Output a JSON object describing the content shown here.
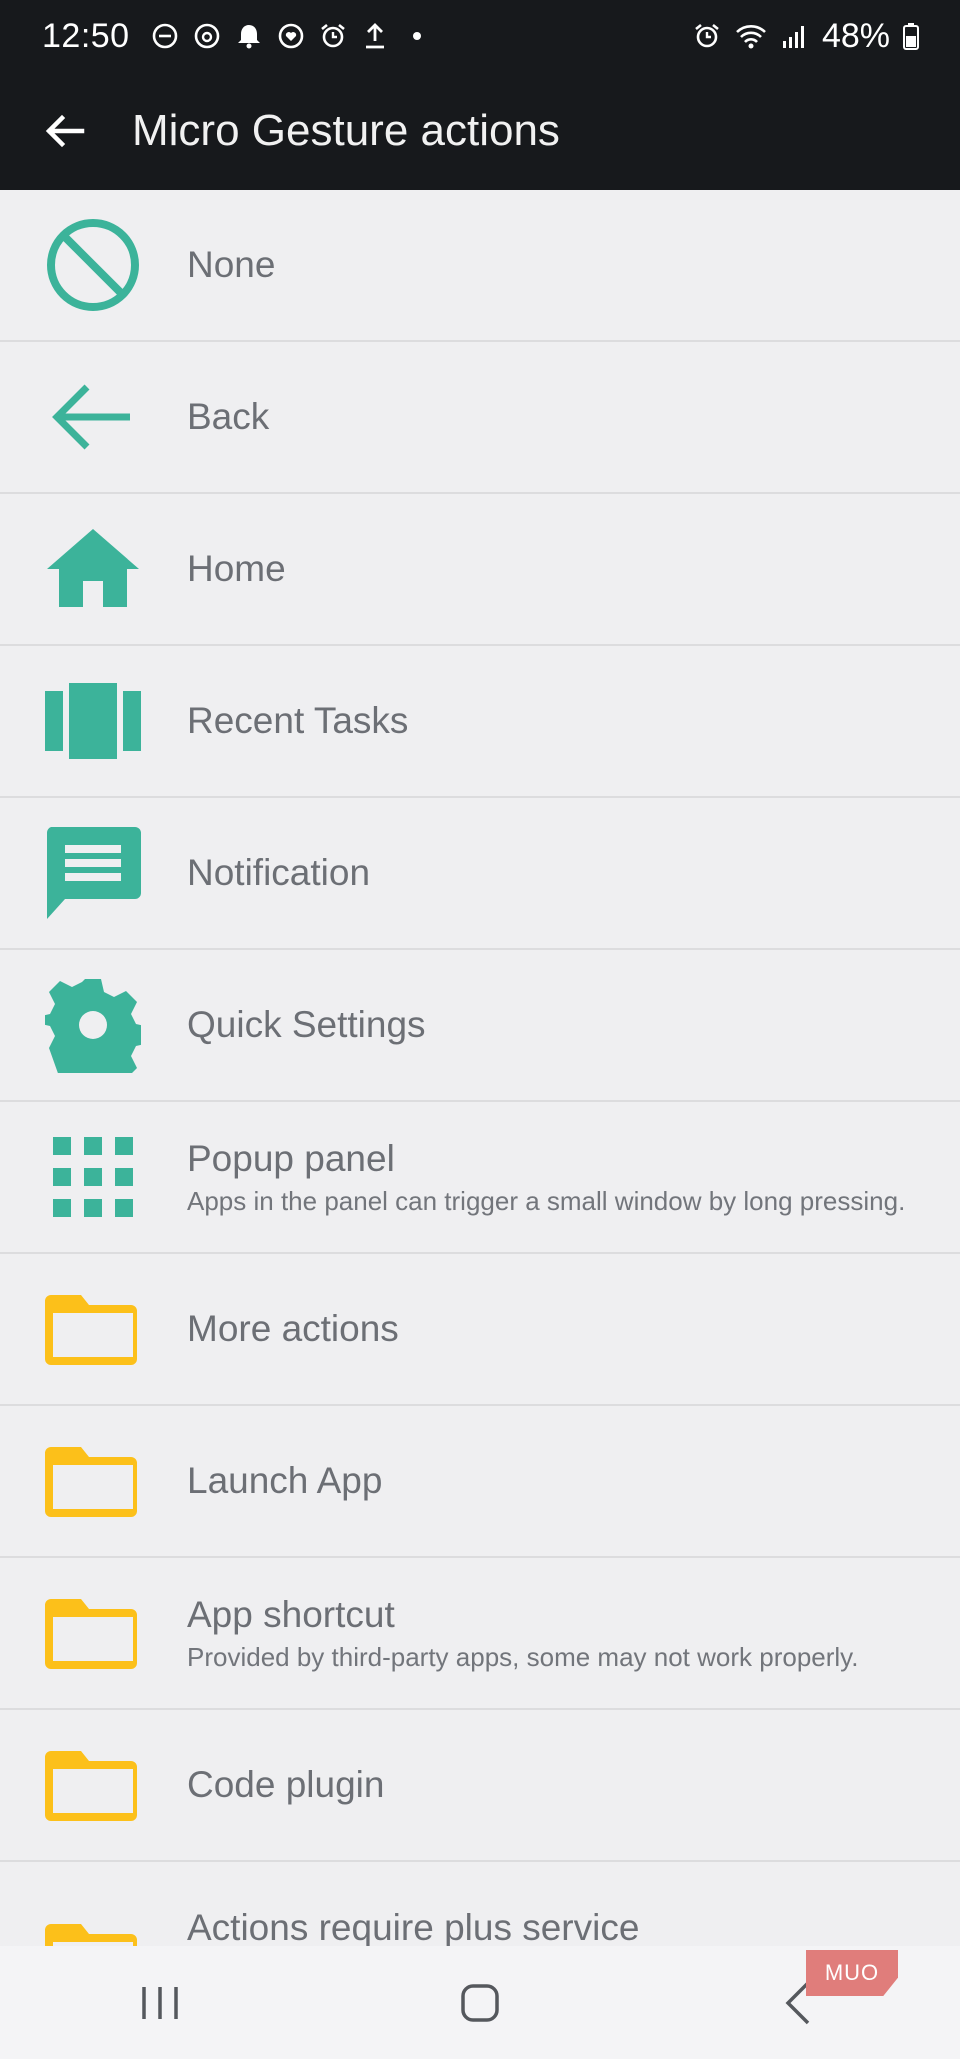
{
  "status_bar": {
    "time": "12:50",
    "battery": "48%",
    "icons_left": [
      "dnd-icon",
      "threads-icon",
      "bell-icon",
      "heart-sync-icon",
      "alarm-icon",
      "upload-icon",
      "dot-icon"
    ],
    "icons_right": [
      "alarm-icon",
      "wifi-icon",
      "signal-icon",
      "battery-icon"
    ]
  },
  "app_bar": {
    "title": "Micro Gesture actions",
    "back_icon": "arrow-left-icon"
  },
  "colors": {
    "accent_teal": "#3cb39a",
    "folder_yellow": "#fcc01a",
    "bar_dark": "#17191c",
    "list_bg": "#efeff1",
    "text_gray": "#6c6f75"
  },
  "items": [
    {
      "title": "None",
      "icon": "none-icon"
    },
    {
      "title": "Back",
      "icon": "back-arrow-icon"
    },
    {
      "title": "Home",
      "icon": "home-icon"
    },
    {
      "title": "Recent Tasks",
      "icon": "recent-tasks-icon"
    },
    {
      "title": "Notification",
      "icon": "notification-icon"
    },
    {
      "title": "Quick Settings",
      "icon": "gear-icon"
    },
    {
      "title": "Popup panel",
      "subtitle": "Apps in the panel can trigger a small window by long pressing.",
      "icon": "grid-icon"
    },
    {
      "title": "More actions",
      "icon": "folder-icon"
    },
    {
      "title": "Launch App",
      "icon": "folder-icon"
    },
    {
      "title": "App shortcut",
      "subtitle": "Provided by third-party apps, some may not work properly.",
      "icon": "folder-icon"
    },
    {
      "title": "Code plugin",
      "icon": "folder-icon"
    },
    {
      "title": "Actions require plus service",
      "icon": "folder-icon"
    }
  ],
  "nav_bar": {
    "buttons": [
      "recents-nav-icon",
      "home-nav-icon",
      "back-nav-icon"
    ]
  },
  "watermark": "MUO"
}
